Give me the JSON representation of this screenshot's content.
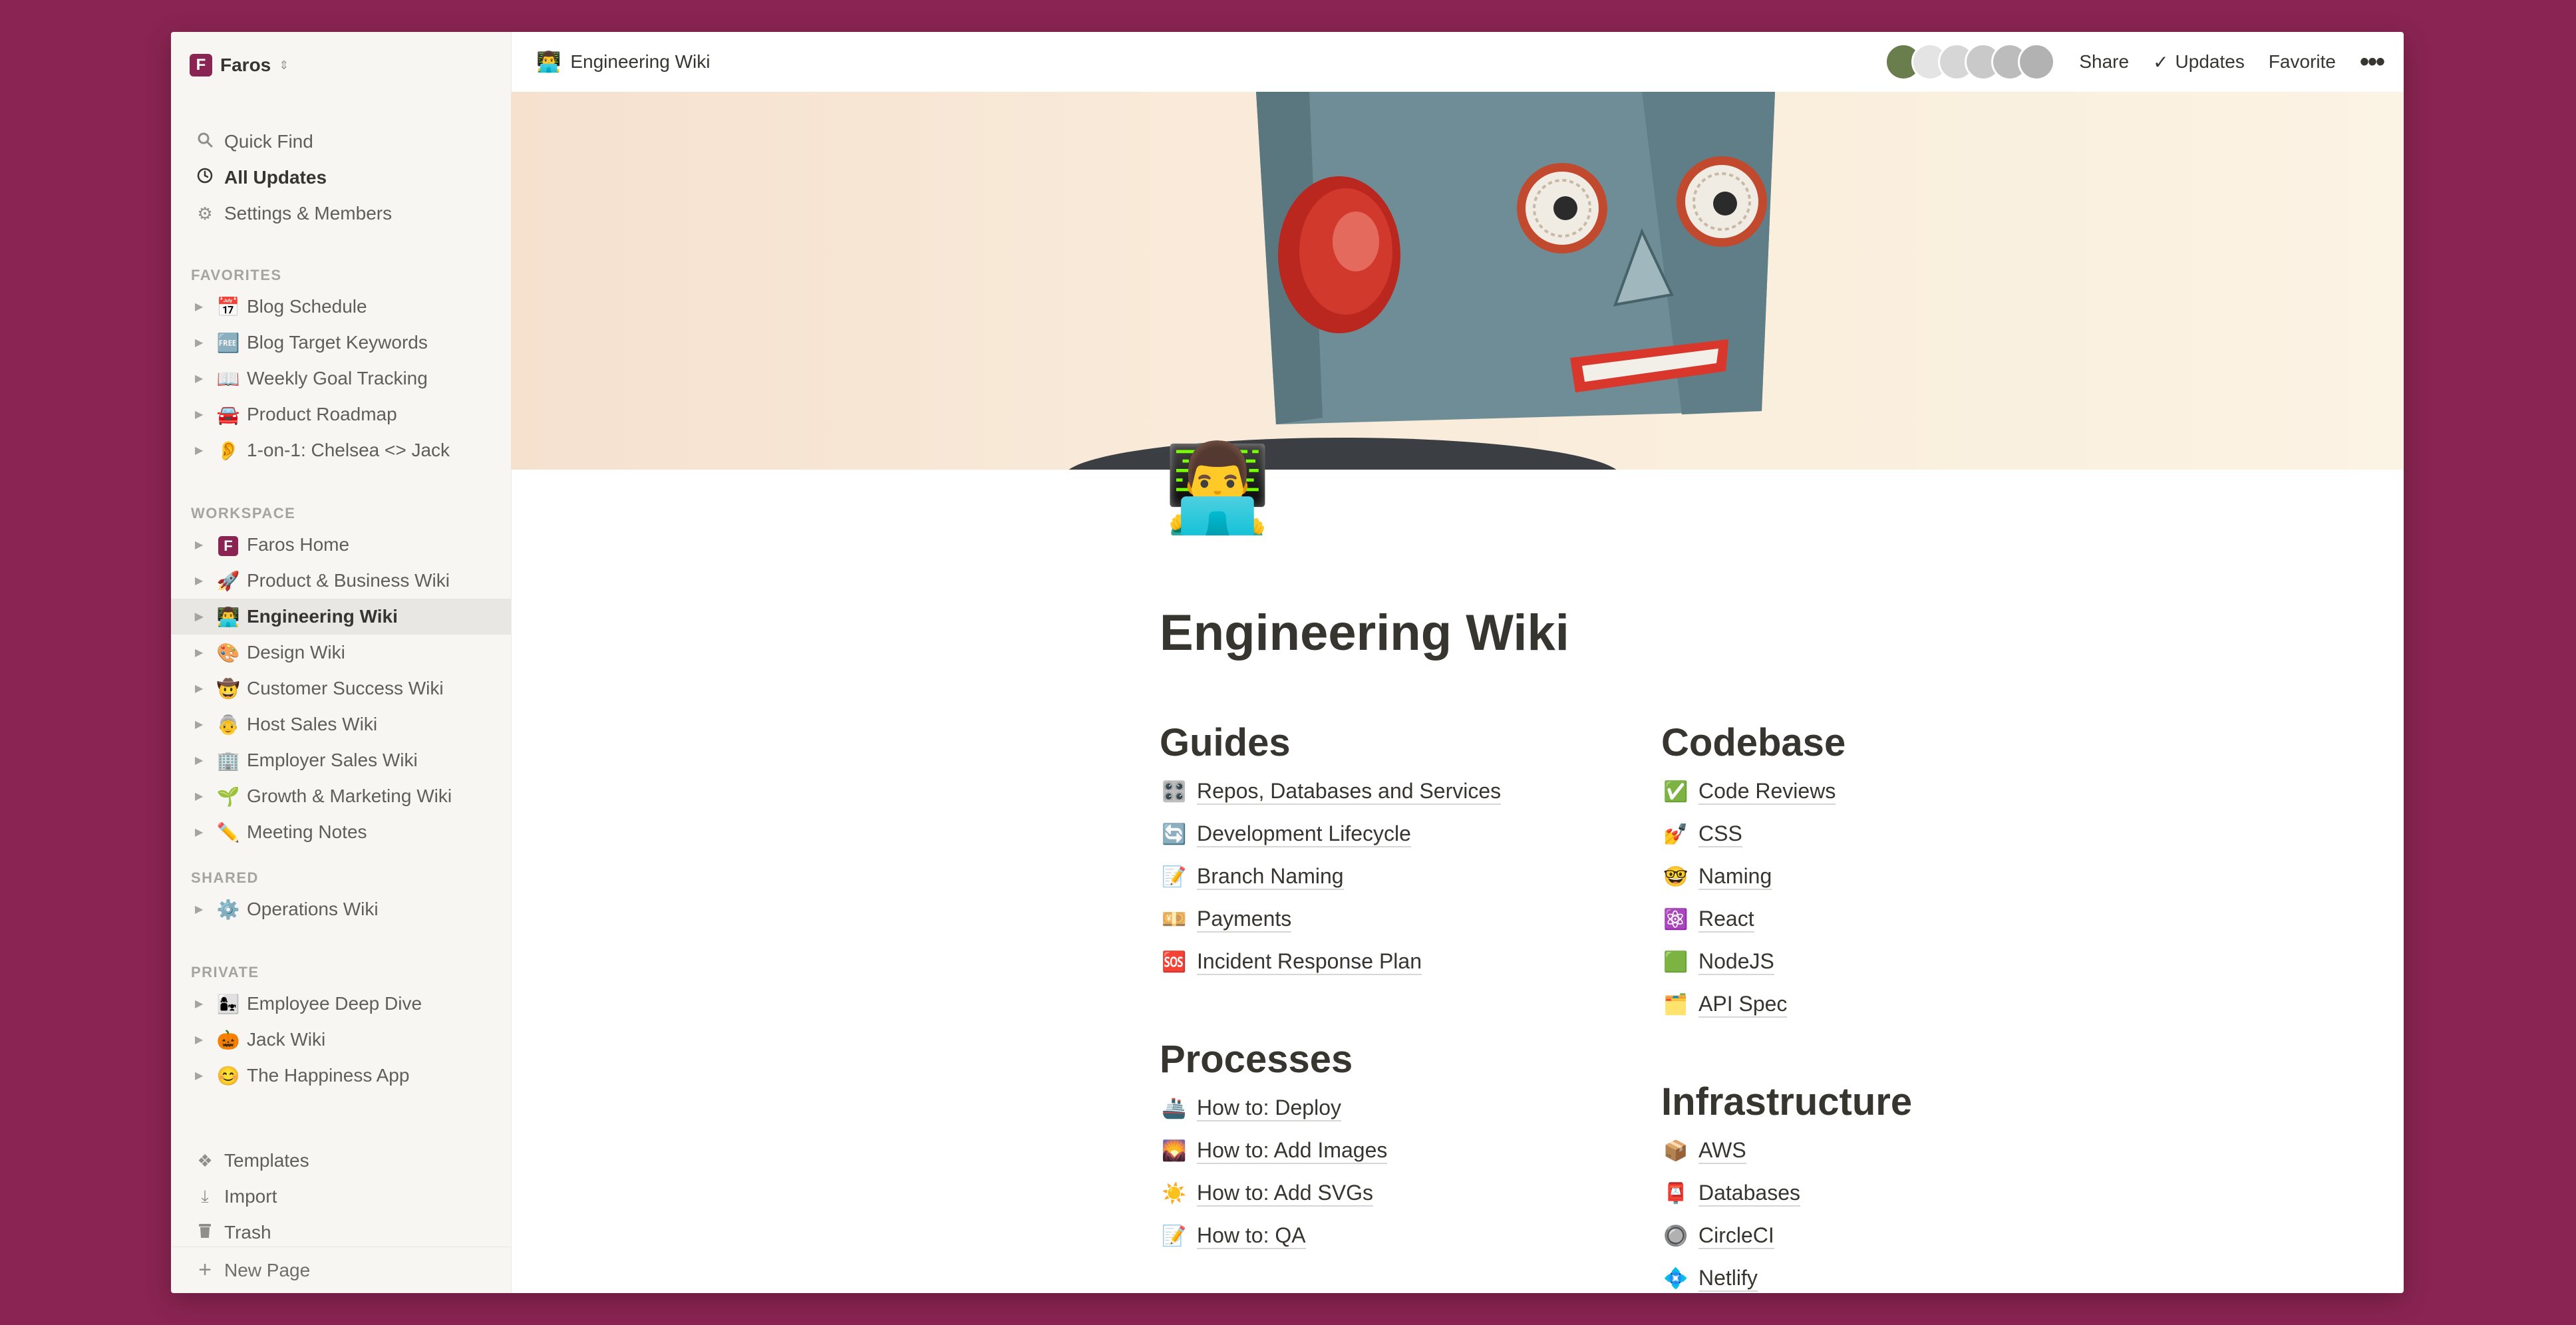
{
  "workspace": {
    "name": "Faros",
    "logo_letter": "F"
  },
  "sidebar": {
    "top_items": [
      {
        "label": "Quick Find",
        "icon": "search-icon"
      },
      {
        "label": "All Updates",
        "icon": "clock-icon"
      },
      {
        "label": "Settings & Members",
        "icon": "gear-icon"
      }
    ],
    "favorites_label": "FAVORITES",
    "favorites": [
      {
        "emoji": "📅",
        "label": "Blog Schedule"
      },
      {
        "emoji": "🆓",
        "label": "Blog Target Keywords"
      },
      {
        "emoji": "📖",
        "label": "Weekly Goal Tracking"
      },
      {
        "emoji": "🚘",
        "label": "Product Roadmap"
      },
      {
        "emoji": "👂",
        "label": "1-on-1: Chelsea <> Jack"
      }
    ],
    "workspace_label": "WORKSPACE",
    "workspace_pages": [
      {
        "emoji": "F",
        "label": "Faros Home"
      },
      {
        "emoji": "🚀",
        "label": "Product & Business Wiki"
      },
      {
        "emoji": "👨‍💻",
        "label": "Engineering Wiki"
      },
      {
        "emoji": "🎨",
        "label": "Design Wiki"
      },
      {
        "emoji": "🤠",
        "label": "Customer Success Wiki"
      },
      {
        "emoji": "👵",
        "label": "Host Sales Wiki"
      },
      {
        "emoji": "🏢",
        "label": "Employer Sales Wiki"
      },
      {
        "emoji": "🌱",
        "label": "Growth & Marketing Wiki"
      },
      {
        "emoji": "✏️",
        "label": "Meeting Notes"
      }
    ],
    "shared_label": "SHARED",
    "shared_pages": [
      {
        "emoji": "⚙️",
        "label": "Operations Wiki"
      }
    ],
    "private_label": "PRIVATE",
    "private_pages": [
      {
        "emoji": "👩‍👧",
        "label": "Employee Deep Dive"
      },
      {
        "emoji": "🎃",
        "label": "Jack Wiki"
      },
      {
        "emoji": "😊",
        "label": "The Happiness App"
      }
    ],
    "bottom_items": [
      {
        "label": "Templates",
        "icon": "templates-icon"
      },
      {
        "label": "Import",
        "icon": "download-icon"
      },
      {
        "label": "Trash",
        "icon": "trash-icon"
      }
    ],
    "new_page_label": "New Page"
  },
  "topbar": {
    "breadcrumb_emoji": "👨‍💻",
    "breadcrumb": "Engineering Wiki",
    "share": "Share",
    "updates": "Updates",
    "favorite": "Favorite",
    "more": "•••"
  },
  "page": {
    "icon": "👨‍💻",
    "title": "Engineering Wiki",
    "guides": {
      "heading": "Guides",
      "links": [
        {
          "emoji": "🎛️",
          "label": "Repos, Databases and Services"
        },
        {
          "emoji": "🔄",
          "label": "Development Lifecycle"
        },
        {
          "emoji": "📝",
          "label": "Branch Naming"
        },
        {
          "emoji": "💴",
          "label": "Payments"
        },
        {
          "emoji": "🆘",
          "label": "Incident Response Plan"
        }
      ]
    },
    "processes": {
      "heading": "Processes",
      "links": [
        {
          "emoji": "🚢",
          "label": "How to: Deploy"
        },
        {
          "emoji": "🌄",
          "label": "How to: Add Images"
        },
        {
          "emoji": "☀️",
          "label": "How to: Add SVGs"
        },
        {
          "emoji": "📝",
          "label": "How to: QA"
        }
      ]
    },
    "codebase": {
      "heading": "Codebase",
      "links": [
        {
          "emoji": "✅",
          "label": "Code Reviews"
        },
        {
          "emoji": "💅",
          "label": "CSS"
        },
        {
          "emoji": "🤓",
          "label": "Naming"
        },
        {
          "emoji": "⚛️",
          "label": "React"
        },
        {
          "emoji": "🟩",
          "label": "NodeJS"
        },
        {
          "emoji": "🗂️",
          "label": "API Spec"
        }
      ]
    },
    "infrastructure": {
      "heading": "Infrastructure",
      "links": [
        {
          "emoji": "📦",
          "label": "AWS"
        },
        {
          "emoji": "📮",
          "label": "Databases"
        },
        {
          "emoji": "🔘",
          "label": "CircleCI"
        },
        {
          "emoji": "💠",
          "label": "Netlify"
        }
      ]
    }
  },
  "colors": {
    "background": "#8a2452",
    "sidebar": "#f7f6f3",
    "text": "#37352f",
    "brand": "#8a2452"
  }
}
